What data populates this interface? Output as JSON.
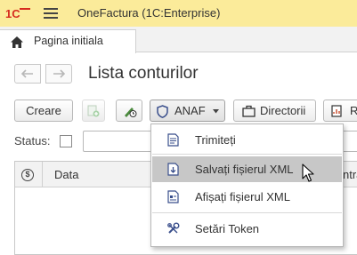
{
  "titlebar": {
    "logo_text": "1С",
    "app_title": "OneFactura  (1C:Enterprise)"
  },
  "tabs": [
    {
      "label": "Pagina initiala"
    }
  ],
  "page": {
    "title": "Lista conturilor"
  },
  "toolbar": {
    "create_label": "Creare",
    "anaf_label": "ANAF",
    "directories_label": "Directorii",
    "more_label": "R"
  },
  "filter": {
    "status_label": "Status:",
    "status_checked": false,
    "status_value": ""
  },
  "table": {
    "columns": [
      "Data",
      "ntra"
    ]
  },
  "anaf_menu": {
    "items": [
      {
        "label": "Trimiteți",
        "icon": "send-icon"
      },
      {
        "label": "Salvați fișierul XML",
        "icon": "save-xml-icon",
        "highlighted": true
      },
      {
        "label": "Afișați fișierul XML",
        "icon": "show-xml-icon"
      },
      {
        "label": "Setări Token",
        "icon": "token-settings-icon"
      }
    ]
  },
  "colors": {
    "titlebar_bg": "#fbeb9a",
    "logo_red": "#d62b1f",
    "menu_highlight": "#c7c7c7",
    "icon_blue": "#3a4f8c"
  }
}
